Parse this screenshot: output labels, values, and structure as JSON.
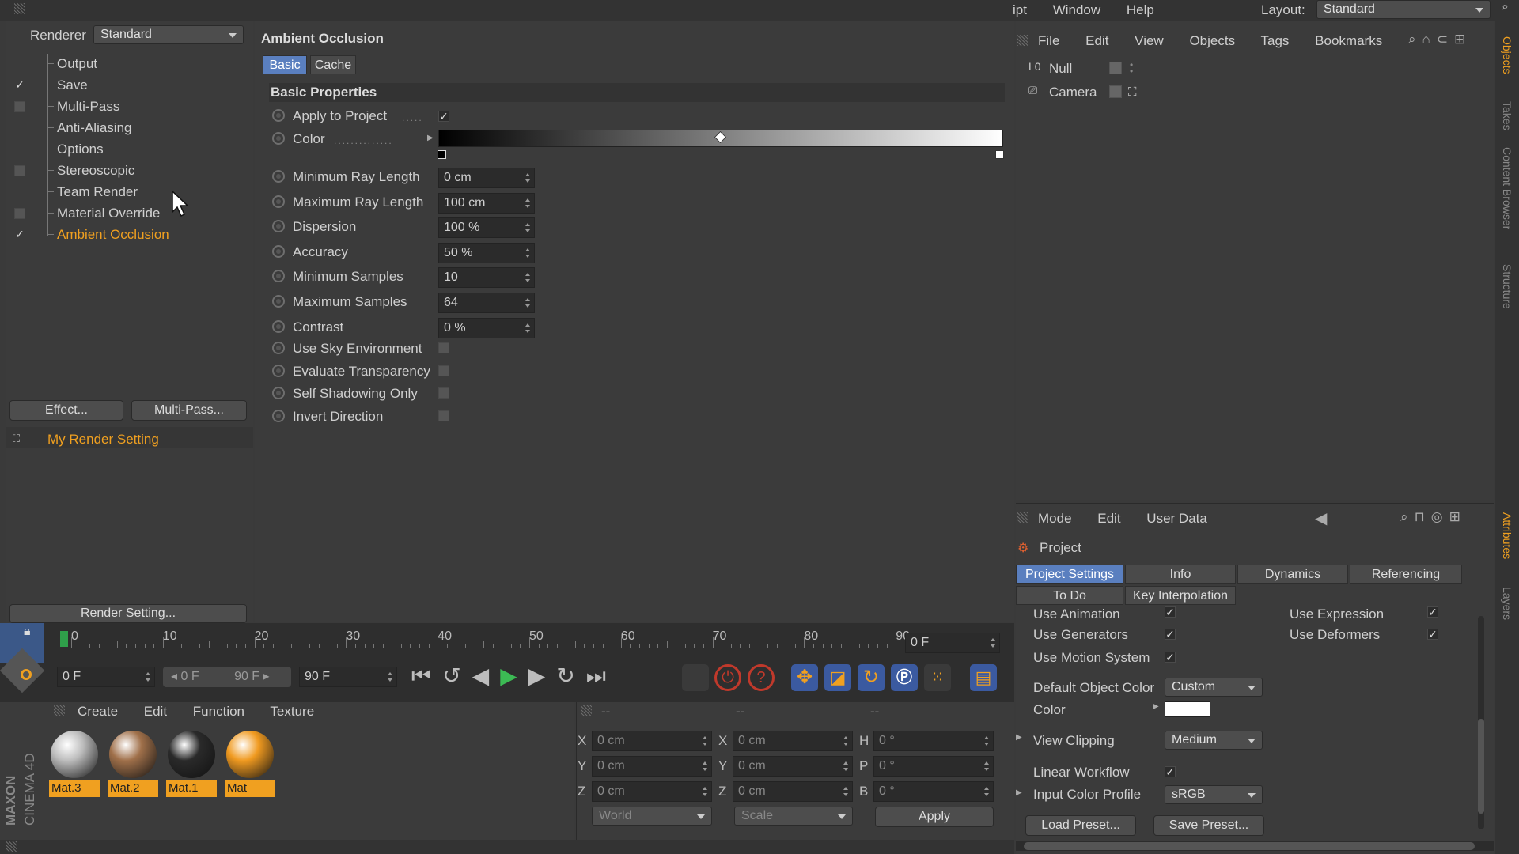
{
  "app": {
    "brand_maxon": "MAXON",
    "brand_cinema": "CINEMA 4D"
  },
  "top_menu": {
    "items": [
      "ipt",
      "Window",
      "Help"
    ],
    "layout_label": "Layout:",
    "layout_value": "Standard"
  },
  "render_settings": {
    "renderer_label": "Renderer",
    "renderer_value": "Standard",
    "tree": [
      {
        "label": "Output",
        "check": "none"
      },
      {
        "label": "Save",
        "check": "checked"
      },
      {
        "label": "Multi-Pass",
        "check": "box"
      },
      {
        "label": "Anti-Aliasing",
        "check": "none"
      },
      {
        "label": "Options",
        "check": "none"
      },
      {
        "label": "Stereoscopic",
        "check": "box"
      },
      {
        "label": "Team Render",
        "check": "none"
      },
      {
        "label": "Material Override",
        "check": "box"
      },
      {
        "label": "Ambient Occlusion",
        "check": "checked",
        "active": true
      }
    ],
    "effect_button": "Effect...",
    "multipass_button": "Multi-Pass...",
    "setting_name": "My Render Setting",
    "render_setting_button": "Render Setting..."
  },
  "ao": {
    "title": "Ambient Occlusion",
    "tabs": [
      "Basic",
      "Cache"
    ],
    "section": "Basic Properties",
    "apply_label": "Apply to Project",
    "color_label": "Color",
    "fields": [
      {
        "label": "Minimum Ray Length",
        "value": "0 cm"
      },
      {
        "label": "Maximum Ray Length",
        "value": "100 cm"
      },
      {
        "label": "Dispersion",
        "value": "100 %"
      },
      {
        "label": "Accuracy",
        "value": "50 %"
      },
      {
        "label": "Minimum Samples",
        "value": "10"
      },
      {
        "label": "Maximum Samples",
        "value": "64"
      },
      {
        "label": "Contrast",
        "value": "0 %"
      }
    ],
    "checks": [
      {
        "label": "Use Sky Environment"
      },
      {
        "label": "Evaluate Transparency"
      },
      {
        "label": "Self Shadowing Only"
      },
      {
        "label": "Invert Direction"
      }
    ]
  },
  "objects": {
    "menu": [
      "File",
      "Edit",
      "View",
      "Objects",
      "Tags",
      "Bookmarks"
    ],
    "items": [
      {
        "name": "Null"
      },
      {
        "name": "Camera"
      }
    ]
  },
  "side_tabs": [
    "Objects",
    "Takes",
    "Content Browser",
    "Structure",
    "Attributes",
    "Layers"
  ],
  "attributes": {
    "menu": [
      "Mode",
      "Edit",
      "User Data"
    ],
    "object_title": "Project",
    "tabs_row1": [
      "Project Settings",
      "Info",
      "Dynamics",
      "Referencing"
    ],
    "tabs_row2": [
      "To Do",
      "Key Interpolation"
    ],
    "use_animation": "Use Animation",
    "use_expression": "Use Expression",
    "use_generators": "Use Generators",
    "use_deformers": "Use Deformers",
    "use_motion": "Use Motion System",
    "default_color_label": "Default Object Color",
    "default_color_value": "Custom",
    "color_label": "Color",
    "view_clipping_label": "View Clipping",
    "view_clipping_value": "Medium",
    "linear_workflow_label": "Linear Workflow",
    "input_profile_label": "Input Color Profile",
    "input_profile_value": "sRGB",
    "load_preset": "Load Preset...",
    "save_preset": "Save Preset..."
  },
  "timeline": {
    "ticks": [
      "0",
      "10",
      "20",
      "30",
      "40",
      "50",
      "60",
      "70",
      "80",
      "90"
    ],
    "frame_display": "0 F",
    "start_field": "0 F",
    "range_start": "0 F",
    "range_end": "90 F",
    "end_field": "90 F"
  },
  "materials": {
    "menu": [
      "Create",
      "Edit",
      "Function",
      "Texture"
    ],
    "items": [
      {
        "name": "Mat.3",
        "color": "#bdbdbd"
      },
      {
        "name": "Mat.2",
        "color": "#a0704a"
      },
      {
        "name": "Mat.1",
        "color": "#2a2a2a"
      },
      {
        "name": "Mat",
        "color": "#f09a20"
      }
    ]
  },
  "coords": {
    "headers": [
      "--",
      "--",
      "--"
    ],
    "rows": [
      {
        "a": "X",
        "av": "0 cm",
        "b": "X",
        "bv": "0 cm",
        "c": "H",
        "cv": "0 °"
      },
      {
        "a": "Y",
        "av": "0 cm",
        "b": "Y",
        "bv": "0 cm",
        "c": "P",
        "cv": "0 °"
      },
      {
        "a": "Z",
        "av": "0 cm",
        "b": "Z",
        "bv": "0 cm",
        "c": "B",
        "cv": "0 °"
      }
    ],
    "space": "World",
    "mode": "Scale",
    "apply": "Apply"
  },
  "colors": {
    "accent": "#f0a020",
    "tab_active": "#5a7fbf"
  }
}
